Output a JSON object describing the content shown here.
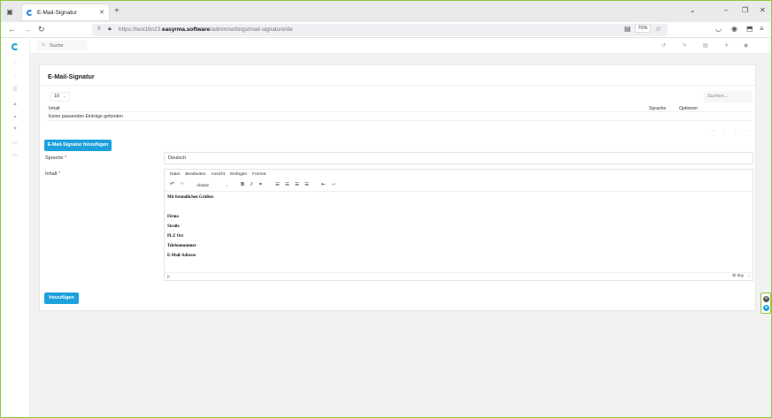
{
  "browser": {
    "tab_title": "E-Mail-Signatur",
    "url_prefix": "https://test16n23.",
    "url_domain": "easyrma.software",
    "url_path": "/admin/settings/mail-signature/de",
    "zoom": "70%"
  },
  "header": {
    "search_placeholder": "Suche"
  },
  "card": {
    "title": "E-Mail-Signatur",
    "page_size": "10",
    "table_search_placeholder": "Suchen...",
    "columns": [
      "Inhalt",
      "Sprache",
      "Optionen"
    ],
    "empty_message": "Keine passenden Einträge gefunden",
    "add_signature_button": "E-Mail-Signatur hinzufügen"
  },
  "form": {
    "language_label": "Sprache",
    "language_value": "Deutsch",
    "content_label": "Inhalt",
    "required_mark": "*",
    "submit_button": "hinzufügen"
  },
  "editor": {
    "menu": [
      "Datei",
      "Bearbeiten",
      "Ansicht",
      "Einfügen",
      "Format"
    ],
    "block_format": "Absatz",
    "content_lines": [
      "Mit freundlichen Grüßen",
      "Firma",
      "Straße",
      "PLZ Ort",
      "Telefonnummer",
      "E-Mail-Adresse"
    ],
    "status_path": "p",
    "brand": "tiny"
  }
}
